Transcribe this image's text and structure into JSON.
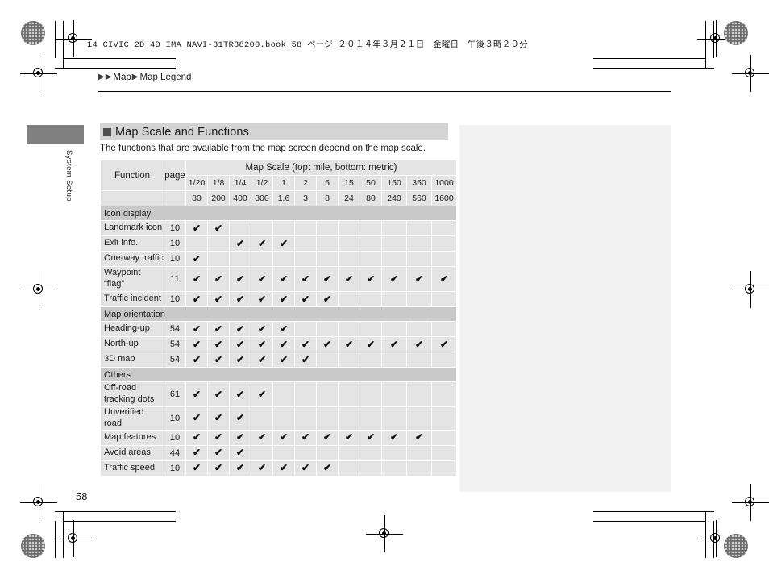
{
  "print_header": {
    "file_line": "14 CIVIC 2D 4D IMA NAVI-31TR38200.book  58 ページ   ２０１４年３月２１日　金曜日　午後３時２０分"
  },
  "breadcrumb": {
    "arrow_glyph": "▶",
    "items": [
      "Map",
      "Map Legend"
    ]
  },
  "sidebar": {
    "tab_label": "System Setup"
  },
  "section": {
    "title": "Map Scale and Functions",
    "intro": "The functions that are available from the map screen depend on the map scale."
  },
  "table": {
    "col_function": "Function",
    "col_page": "page",
    "scale_title": "Map Scale (top: mile, bottom: metric)",
    "scale_mile": [
      "1/20",
      "1/8",
      "1/4",
      "1/2",
      "1",
      "2",
      "5",
      "15",
      "50",
      "150",
      "350",
      "1000"
    ],
    "scale_metric": [
      "80",
      "200",
      "400",
      "800",
      "1.6",
      "3",
      "8",
      "24",
      "80",
      "240",
      "560",
      "1600"
    ],
    "check_glyph": "✔",
    "sections": [
      {
        "name": "Icon display",
        "rows": [
          {
            "function": "Landmark icon",
            "page": "10",
            "checks": [
              1,
              1,
              0,
              0,
              0,
              0,
              0,
              0,
              0,
              0,
              0,
              0
            ]
          },
          {
            "function": "Exit info.",
            "page": "10",
            "checks": [
              0,
              0,
              1,
              1,
              1,
              0,
              0,
              0,
              0,
              0,
              0,
              0
            ]
          },
          {
            "function": "One-way traffic",
            "page": "10",
            "checks": [
              1,
              0,
              0,
              0,
              0,
              0,
              0,
              0,
              0,
              0,
              0,
              0
            ]
          },
          {
            "function": "Waypoint\n“flag”",
            "page": "11",
            "checks": [
              1,
              1,
              1,
              1,
              1,
              1,
              1,
              1,
              1,
              1,
              1,
              1
            ],
            "tall": true
          },
          {
            "function": "Traffic incident",
            "page": "10",
            "checks": [
              1,
              1,
              1,
              1,
              1,
              1,
              1,
              0,
              0,
              0,
              0,
              0
            ]
          }
        ]
      },
      {
        "name": "Map orientation",
        "rows": [
          {
            "function": "Heading-up",
            "page": "54",
            "checks": [
              1,
              1,
              1,
              1,
              1,
              0,
              0,
              0,
              0,
              0,
              0,
              0
            ]
          },
          {
            "function": "North-up",
            "page": "54",
            "checks": [
              1,
              1,
              1,
              1,
              1,
              1,
              1,
              1,
              1,
              1,
              1,
              1
            ]
          },
          {
            "function": "3D map",
            "page": "54",
            "checks": [
              1,
              1,
              1,
              1,
              1,
              1,
              0,
              0,
              0,
              0,
              0,
              0
            ]
          }
        ]
      },
      {
        "name": "Others",
        "rows": [
          {
            "function": "Off-road\ntracking dots",
            "page": "61",
            "checks": [
              1,
              1,
              1,
              1,
              0,
              0,
              0,
              0,
              0,
              0,
              0,
              0
            ],
            "tall": true
          },
          {
            "function": "Unverified road",
            "page": "10",
            "checks": [
              1,
              1,
              1,
              0,
              0,
              0,
              0,
              0,
              0,
              0,
              0,
              0
            ]
          },
          {
            "function": "Map features",
            "page": "10",
            "checks": [
              1,
              1,
              1,
              1,
              1,
              1,
              1,
              1,
              1,
              1,
              1,
              0
            ]
          },
          {
            "function": "Avoid areas",
            "page": "44",
            "checks": [
              1,
              1,
              1,
              0,
              0,
              0,
              0,
              0,
              0,
              0,
              0,
              0
            ]
          },
          {
            "function": "Traffic speed",
            "page": "10",
            "checks": [
              1,
              1,
              1,
              1,
              1,
              1,
              1,
              0,
              0,
              0,
              0,
              0
            ]
          }
        ]
      }
    ]
  },
  "footer": {
    "page_number": "58"
  },
  "colors": {
    "header_gray": "#c9c9c9",
    "cell_gray": "#e4e4e4",
    "scale_cell_gray": "#dcdcdc",
    "tab_gray": "#808080",
    "panel_gray": "#f2f2f2"
  }
}
